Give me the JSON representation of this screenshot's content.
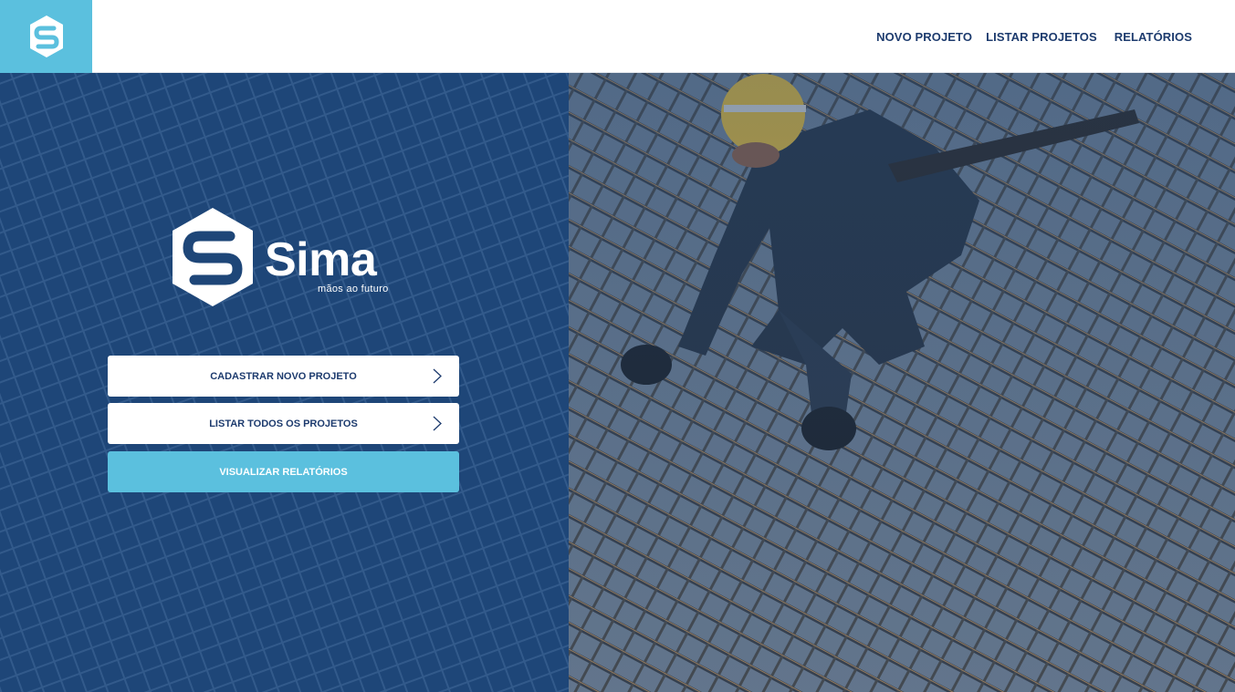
{
  "header": {
    "nav": [
      {
        "label": "NOVO PROJETO"
      },
      {
        "label": "LISTAR PROJETOS"
      },
      {
        "label": "RELATÓRIOS"
      }
    ]
  },
  "brand": {
    "name": "Sima",
    "tagline": "mãos ao futuro"
  },
  "actions": {
    "register": "CADASTRAR NOVO PROJETO",
    "list": "LISTAR TODOS OS PROJETOS",
    "reports": "VISUALIZAR RELATÓRIOS"
  },
  "colors": {
    "accent": "#5bc0de",
    "navy": "#1e4678",
    "text_dark": "#1d3b6e"
  },
  "hero_image": "construction-worker-rebar-photo"
}
